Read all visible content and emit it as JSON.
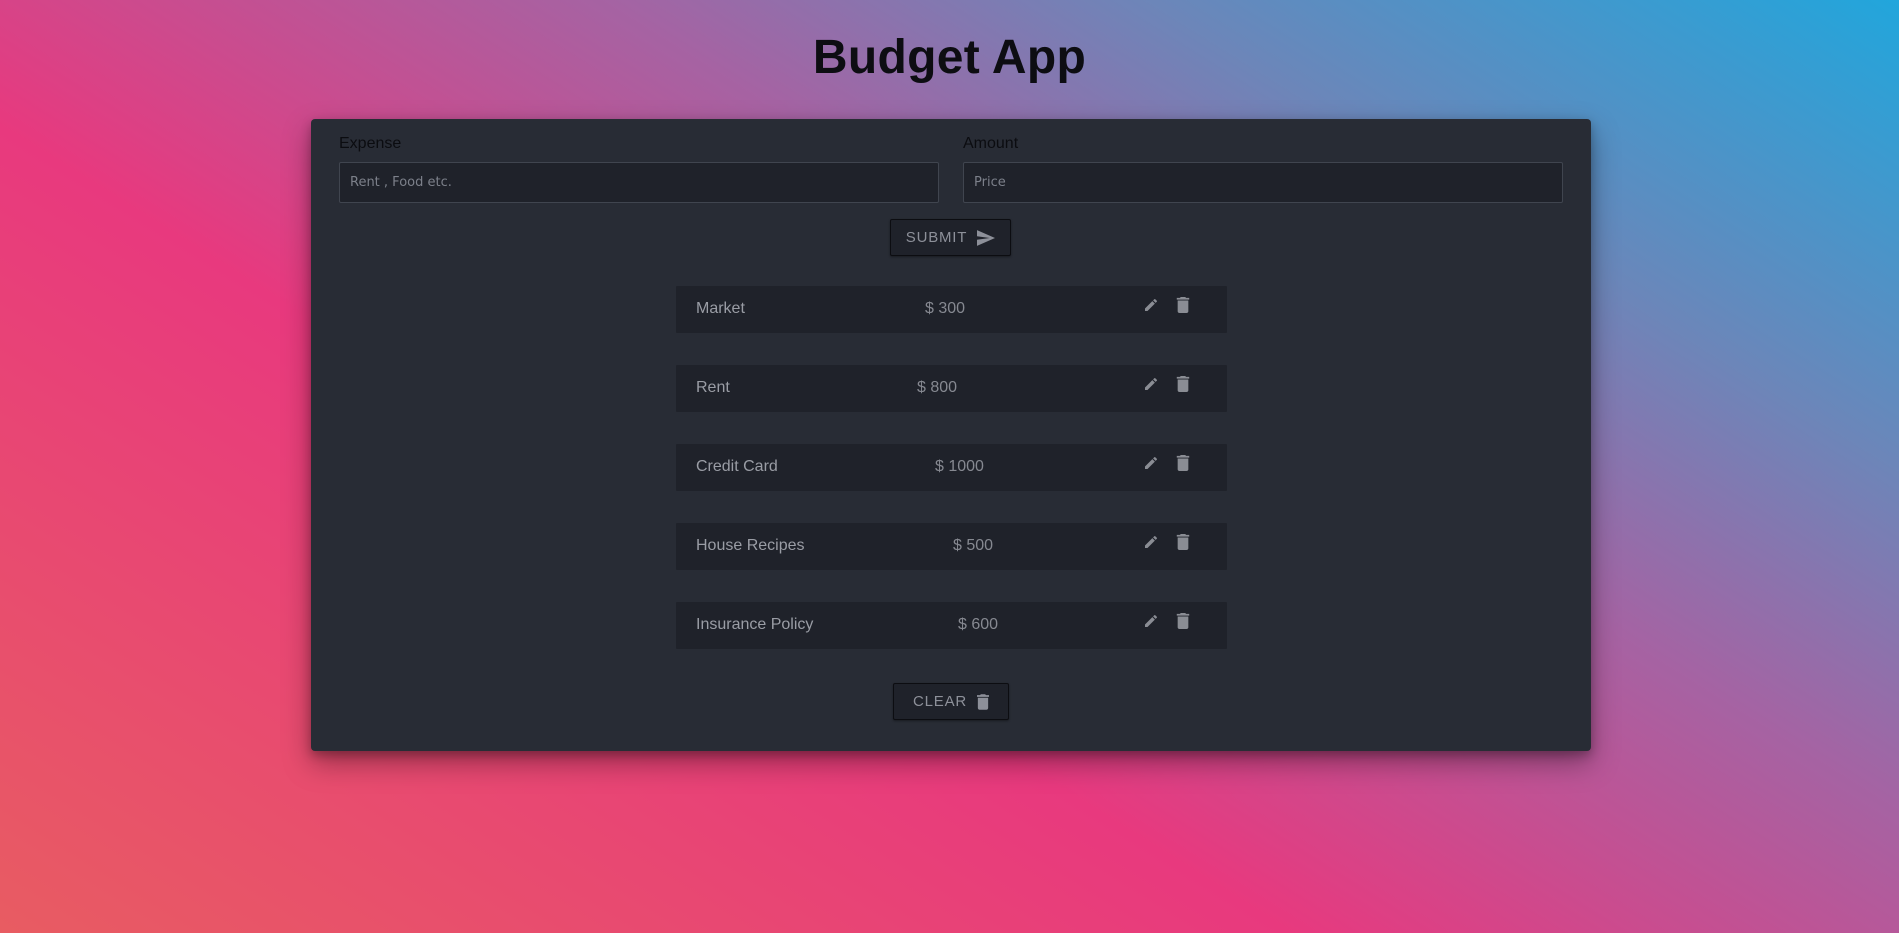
{
  "app": {
    "title": "Budget App"
  },
  "form": {
    "expense_label": "Expense",
    "expense_placeholder": "Rent , Food etc.",
    "expense_value": "",
    "amount_label": "Amount",
    "amount_placeholder": "Price",
    "amount_value": "",
    "submit_label": "SUBMIT",
    "submit_icon": "send-icon"
  },
  "expenses": [
    {
      "name": "Market",
      "amount": "$ 300"
    },
    {
      "name": "Rent",
      "amount": "$ 800"
    },
    {
      "name": "Credit Card",
      "amount": "$ 1000"
    },
    {
      "name": "House Recipes",
      "amount": "$ 500"
    },
    {
      "name": "Insurance Policy",
      "amount": "$ 600"
    }
  ],
  "item_icons": {
    "edit": "pencil-icon",
    "delete": "trash-icon"
  },
  "clear": {
    "label": "CLEAR",
    "icon": "trash-icon"
  },
  "colors": {
    "card_background": "#282c35",
    "item_background": "#1f222a",
    "gradient_start": "#e85c62",
    "gradient_mid": "#e8397e",
    "gradient_end": "#21a6dc"
  }
}
